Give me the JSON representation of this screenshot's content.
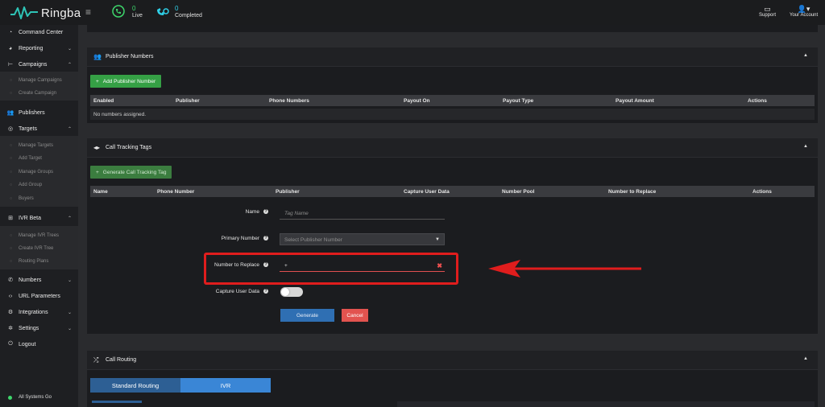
{
  "brand": {
    "name": "Ringba"
  },
  "topbar": {
    "live": {
      "count": "0",
      "label": "Live"
    },
    "completed": {
      "count": "0",
      "label": "Completed"
    },
    "support_label": "Support",
    "account_label": "Your Account"
  },
  "sidebar": {
    "items": [
      {
        "label": "Command Center",
        "icon": "gauge-icon"
      },
      {
        "label": "Reporting",
        "icon": "chart-icon"
      },
      {
        "label": "Campaigns",
        "icon": "sitemap-icon"
      },
      {
        "label": "Publishers",
        "icon": "users-icon"
      },
      {
        "label": "Targets",
        "icon": "target-icon"
      },
      {
        "label": "IVR Beta",
        "icon": "hierarchy-icon"
      },
      {
        "label": "Numbers",
        "icon": "phone-icon"
      },
      {
        "label": "URL Parameters",
        "icon": "code-icon"
      },
      {
        "label": "Integrations",
        "icon": "cogs-icon"
      },
      {
        "label": "Settings",
        "icon": "gear-icon"
      },
      {
        "label": "Logout",
        "icon": "power-icon"
      }
    ],
    "campaigns_sub": [
      "Manage Campaigns",
      "Create Campaign"
    ],
    "targets_sub": [
      "Manage Targets",
      "Add Target",
      "Manage Groups",
      "Add Group",
      "Buyers"
    ],
    "ivr_sub": [
      "Manage IVR Trees",
      "Create IVR Tree",
      "Routing Plans"
    ],
    "status": "All Systems Go"
  },
  "publisher_numbers": {
    "title": "Publisher Numbers",
    "add_button": "Add Publisher Number",
    "columns": [
      "Enabled",
      "Publisher",
      "Phone Numbers",
      "Payout On",
      "Payout Type",
      "Payout Amount",
      "Actions"
    ],
    "empty_text": "No numbers assigned."
  },
  "call_tracking": {
    "title": "Call Tracking Tags",
    "generate_button": "Generate Call Tracking Tag",
    "columns": [
      "Name",
      "Phone Number",
      "Publisher",
      "Capture User Data",
      "Number Pool",
      "Number to Replace",
      "Actions"
    ],
    "form": {
      "name_label": "Name",
      "name_placeholder": "Tag Name",
      "primary_label": "Primary Number",
      "primary_placeholder": "Select Publisher Number",
      "replace_label": "Number to Replace",
      "replace_value": "+",
      "capture_label": "Capture User Data",
      "generate_label": "Generate",
      "cancel_label": "Cancel"
    }
  },
  "call_routing": {
    "title": "Call Routing",
    "tabs": [
      "Standard Routing",
      "IVR"
    ]
  },
  "colors": {
    "accent_green": "#35a045",
    "highlight_red": "#e01d1d",
    "blue": "#2f6fb3"
  }
}
